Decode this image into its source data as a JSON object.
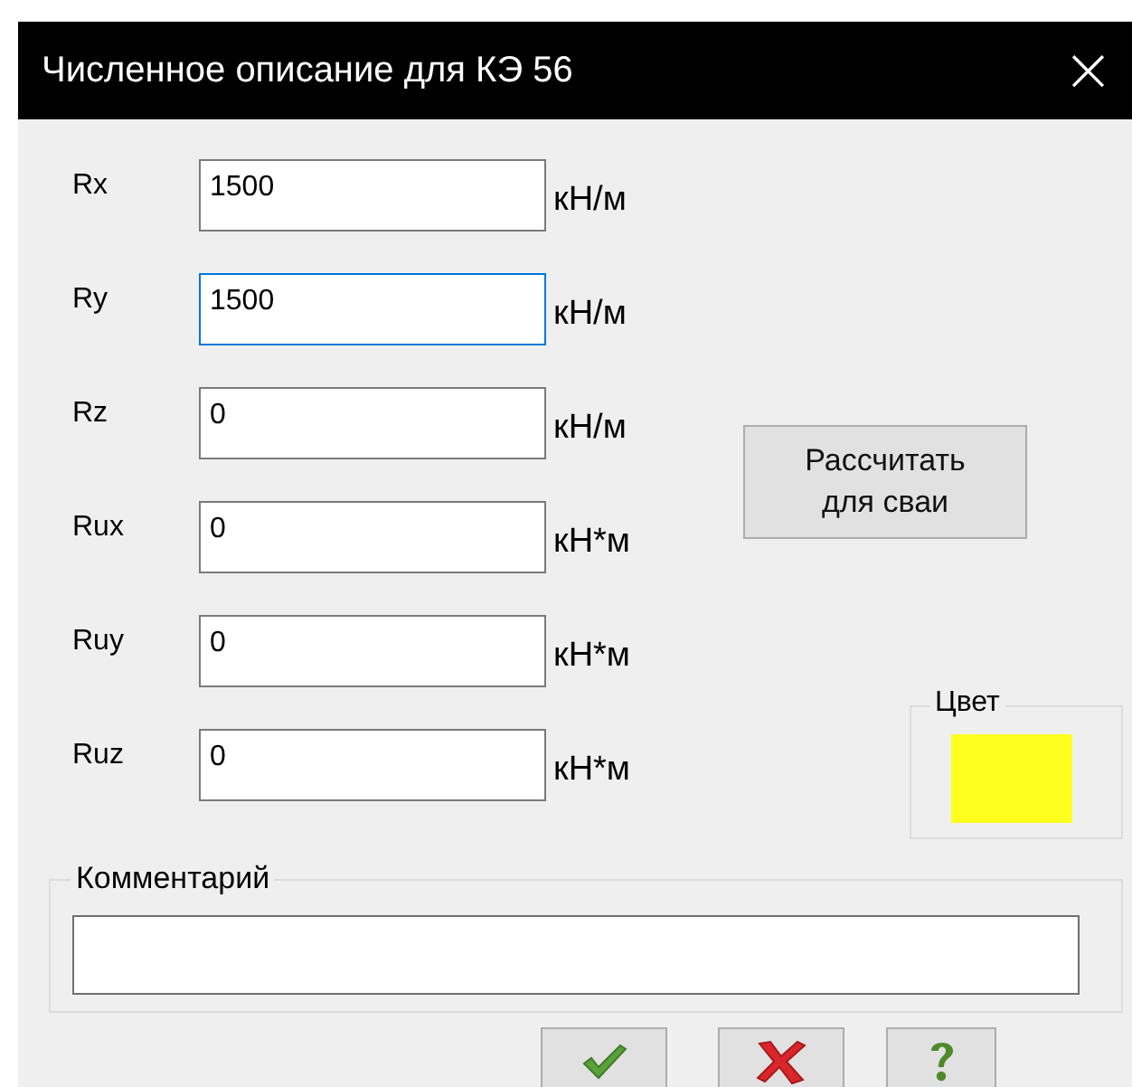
{
  "window": {
    "title": "Численное описание для КЭ 56",
    "close": "×"
  },
  "fields": [
    {
      "label": "Rx",
      "value": "1500",
      "unit": "кН/м",
      "focused": false
    },
    {
      "label": "Ry",
      "value": "1500",
      "unit": "кН/м",
      "focused": true
    },
    {
      "label": "Rz",
      "value": "0",
      "unit": "кН/м",
      "focused": false
    },
    {
      "label": "Rux",
      "value": "0",
      "unit": "кН*м",
      "focused": false
    },
    {
      "label": "Ruy",
      "value": "0",
      "unit": "кН*м",
      "focused": false
    },
    {
      "label": "Ruz",
      "value": "0",
      "unit": "кН*м",
      "focused": false
    }
  ],
  "calc_button": "Рассчитать для сваи",
  "color_group": {
    "label": "Цвет",
    "color": "#ffff1f"
  },
  "comment_group": {
    "label": "Комментарий"
  },
  "buttons": [
    {
      "kind": "ok"
    },
    {
      "kind": "cancel"
    },
    {
      "kind": "help"
    }
  ]
}
